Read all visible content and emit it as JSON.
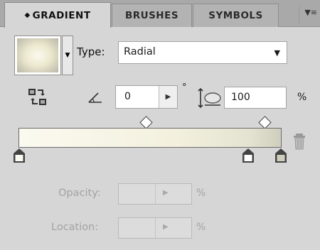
{
  "tabs": [
    {
      "label": "GRADIENT",
      "active": true
    },
    {
      "label": "BRUSHES",
      "active": false
    },
    {
      "label": "SYMBOLS",
      "active": false
    }
  ],
  "gradient": {
    "type_label": "Type:",
    "type_value": "Radial",
    "angle_value": "0",
    "degree_symbol": "°",
    "aspect_value": "100",
    "aspect_unit": "%",
    "stops": [
      {
        "position": 0,
        "color": "#fbfaf0"
      },
      {
        "position": 87,
        "color": "#e4e2d0"
      },
      {
        "position": 100,
        "color": "#cfcebd"
      }
    ],
    "midpoints": [
      50,
      95
    ]
  },
  "opacity": {
    "label": "Opacity:",
    "value": "",
    "unit": "%"
  },
  "location": {
    "label": "Location:",
    "value": "",
    "unit": "%"
  },
  "icons": {
    "tab_collapse": "collapse-diamond-icon",
    "panel_menu": "panel-menu-icon",
    "reverse": "reverse-gradient-icon",
    "angle": "angle-icon",
    "aspect": "aspect-ratio-icon",
    "trash": "trash-icon"
  }
}
